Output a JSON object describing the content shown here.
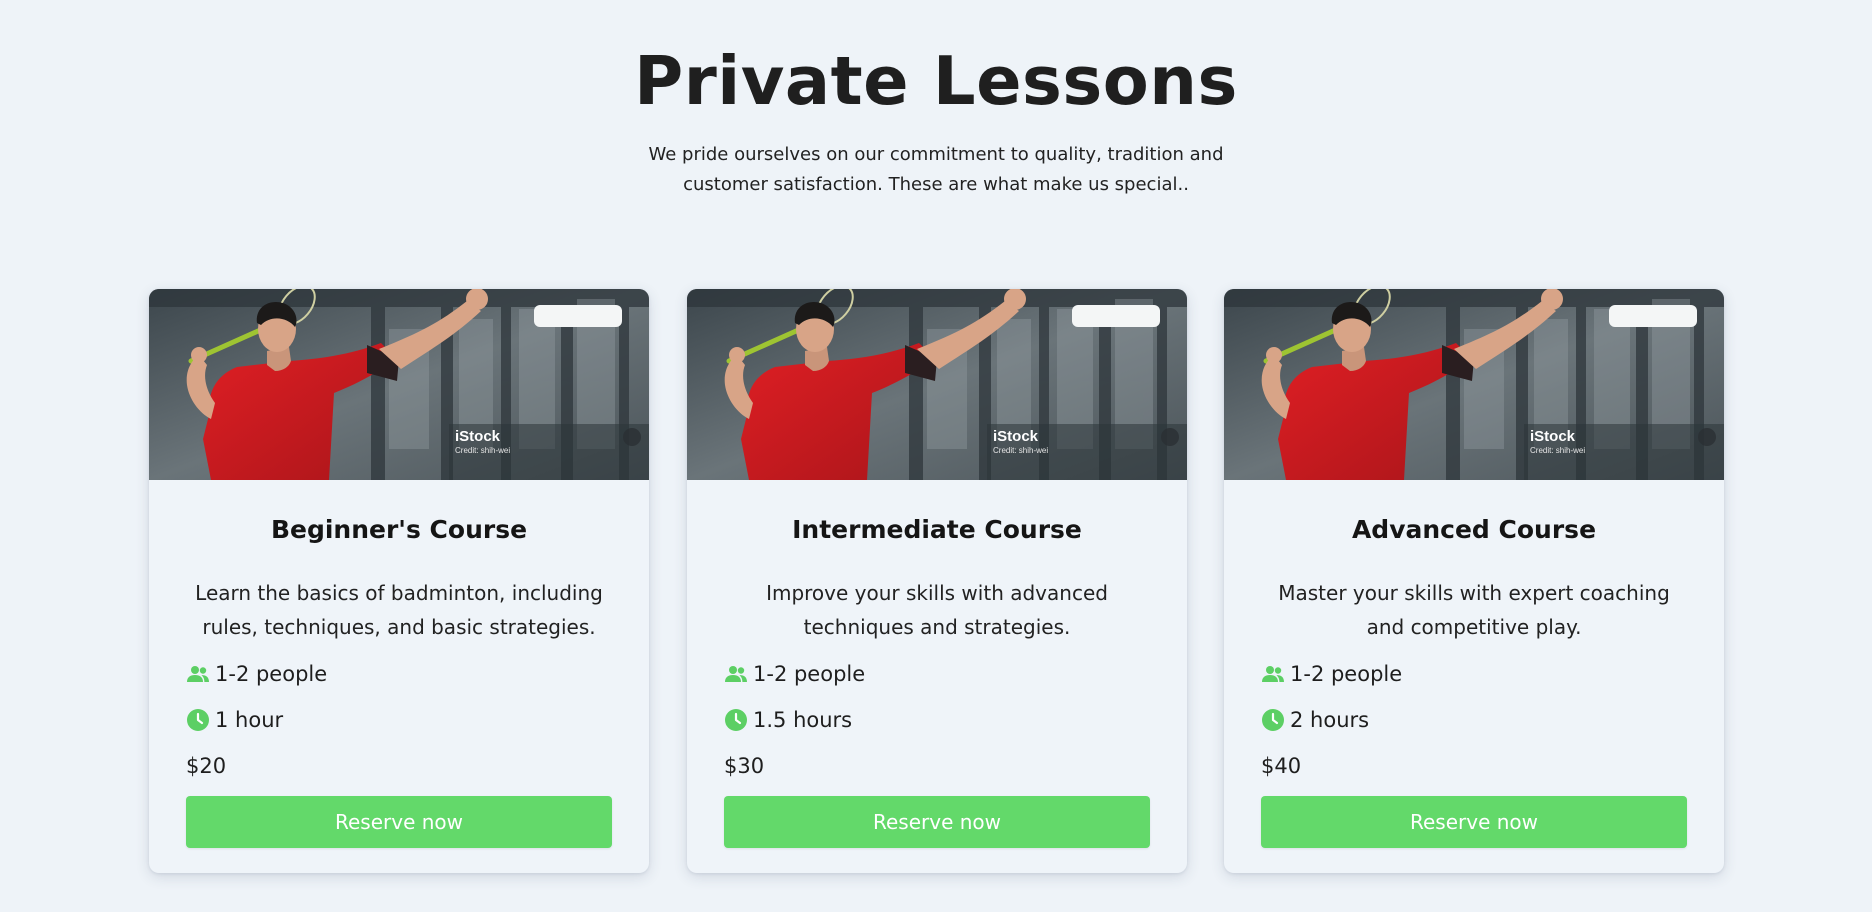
{
  "header": {
    "title": "Private Lessons",
    "subtitle": "We pride ourselves on our commitment to quality, tradition and customer satisfaction. These are what make us special.."
  },
  "colors": {
    "accent": "#63d96a",
    "background": "#eef3f8"
  },
  "image_watermark": {
    "brand": "iStock",
    "credit": "Credit: shih-wei"
  },
  "courses": [
    {
      "title": "Beginner's Course",
      "description": "Learn the basics of badminton, including rules, techniques, and basic strategies.",
      "people": "1-2 people",
      "duration": "1 hour",
      "price": "$20",
      "button_label": "Reserve now"
    },
    {
      "title": "Intermediate Course",
      "description": "Improve your skills with advanced techniques and strategies.",
      "people": "1-2 people",
      "duration": "1.5 hours",
      "price": "$30",
      "button_label": "Reserve now"
    },
    {
      "title": "Advanced Course",
      "description": "Master your skills with expert coaching and competitive play.",
      "people": "1-2 people",
      "duration": "2 hours",
      "price": "$40",
      "button_label": "Reserve now"
    }
  ]
}
